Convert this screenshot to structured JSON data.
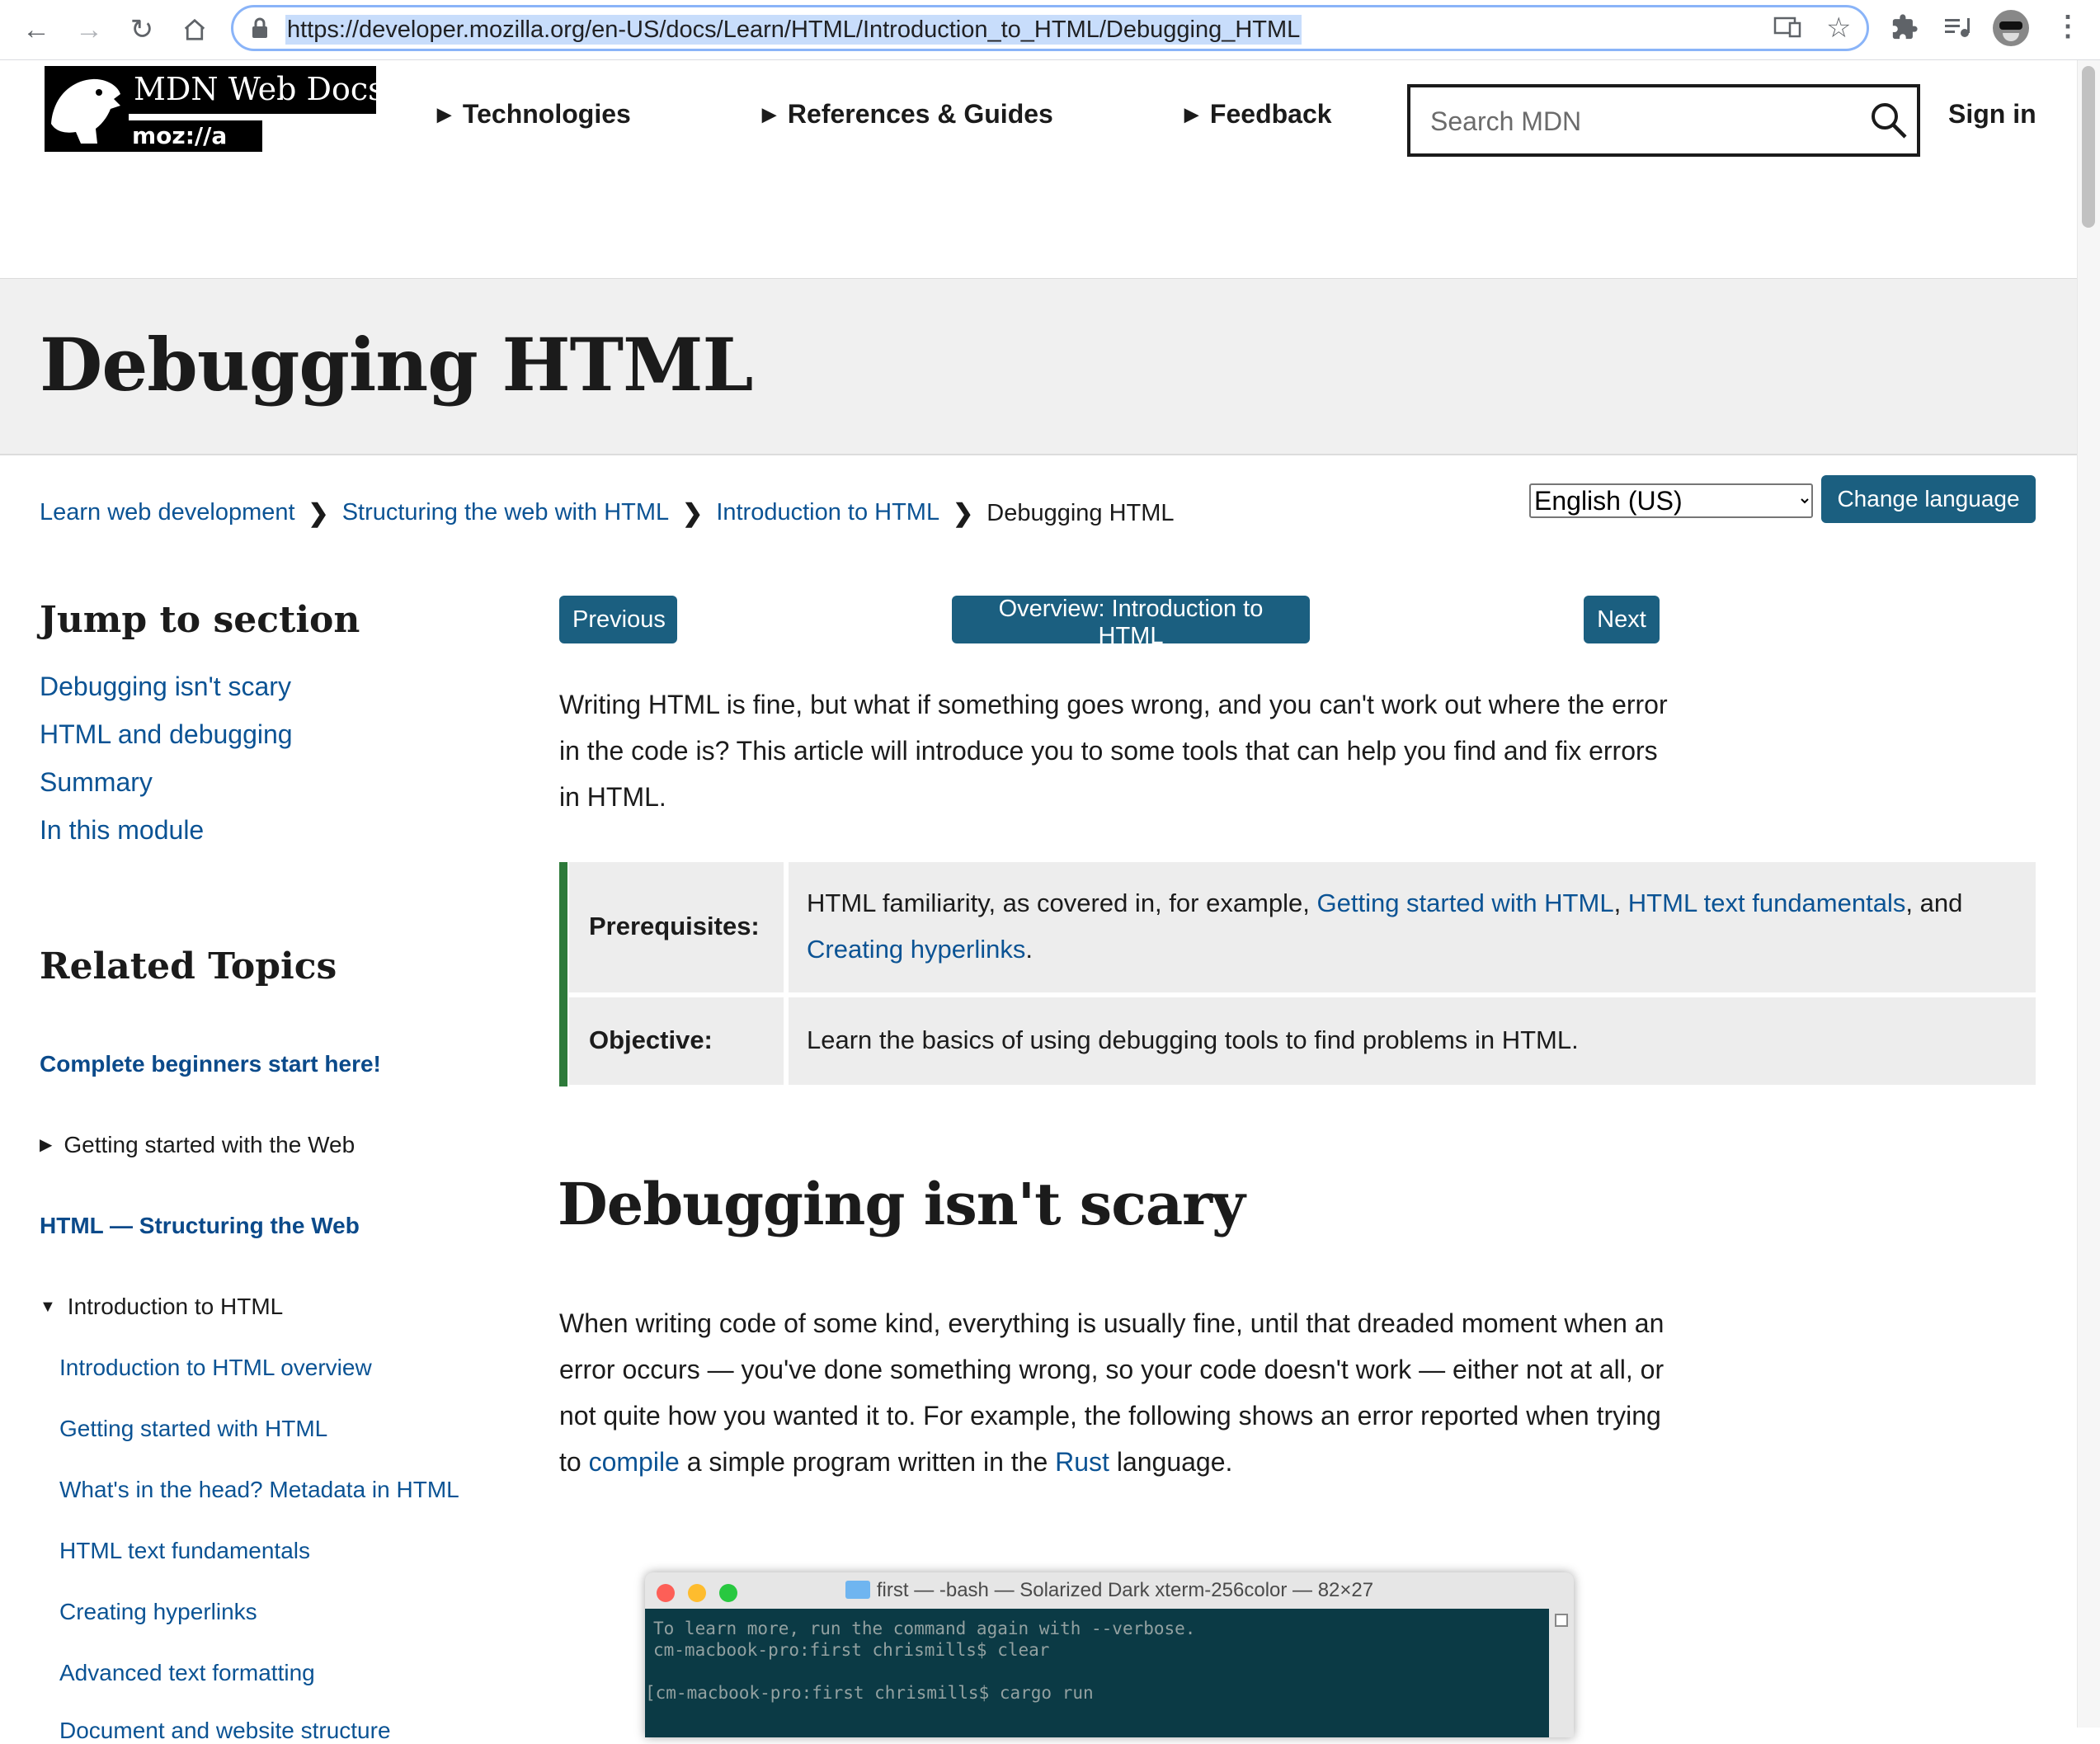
{
  "browser": {
    "url": "https://developer.mozilla.org/en-US/docs/Learn/HTML/Introduction_to_HTML/Debugging_HTML"
  },
  "header": {
    "logo_text": "MDN Web Docs",
    "logo_sub": "moz://a",
    "nav": [
      "Technologies",
      "References & Guides",
      "Feedback"
    ],
    "search_placeholder": "Search MDN",
    "sign_in": "Sign in"
  },
  "page": {
    "title": "Debugging HTML"
  },
  "breadcrumb": {
    "items": [
      "Learn web development",
      "Structuring the web with HTML",
      "Introduction to HTML"
    ],
    "current": "Debugging HTML"
  },
  "language": {
    "selected": "English (US)",
    "button": "Change language"
  },
  "sidebar": {
    "jump_heading": "Jump to section",
    "jump_links": [
      "Debugging isn't scary",
      "HTML and debugging",
      "Summary",
      "In this module"
    ],
    "related_heading": "Related Topics",
    "beginners": "Complete beginners start here!",
    "getting_started_web": "Getting started with the Web",
    "html_structuring": "HTML — Structuring the Web",
    "intro_html": "Introduction to HTML",
    "intro_children": [
      "Introduction to HTML overview",
      "Getting started with HTML",
      "What's in the head? Metadata in HTML",
      "HTML text fundamentals",
      "Creating hyperlinks",
      "Advanced text formatting",
      "Document and website structure"
    ]
  },
  "main": {
    "prev_button": "Previous",
    "overview_button": "Overview: Introduction to HTML",
    "next_button": "Next",
    "intro_paragraph": "Writing HTML is fine, but what if something goes wrong, and you can't work out where the error in the code is? This article will introduce you to some tools that can help you find and fix errors in HTML.",
    "prereq_label": "Prerequisites:",
    "prereq_text_before": "HTML familiarity, as covered in, for example, ",
    "prereq_link1": "Getting started with HTML",
    "prereq_comma": ", ",
    "prereq_link2": "HTML text fundamentals",
    "prereq_and": ", and ",
    "prereq_link3": "Creating hyperlinks",
    "prereq_period": ".",
    "objective_label": "Objective:",
    "objective_text": "Learn the basics of using debugging tools to find problems in HTML.",
    "h2": "Debugging isn't scary",
    "p2_before": "When writing code of some kind, everything is usually fine, until that dreaded moment when an error occurs — you've done something wrong, so your code doesn't work — either not at all, or not quite how you wanted it to. For example, the following shows an error reported when trying to ",
    "p2_link1": "compile",
    "p2_mid": " a simple program written in the ",
    "p2_link2": "Rust",
    "p2_after": " language."
  },
  "terminal": {
    "title": "first — -bash — Solarized Dark xterm-256color — 82×27",
    "lines": [
      "To learn more, run the command again with --verbose.",
      "cm-macbook-pro:first chrismills$ clear",
      "",
      "[cm-macbook-pro:first chrismills$ cargo run"
    ]
  }
}
